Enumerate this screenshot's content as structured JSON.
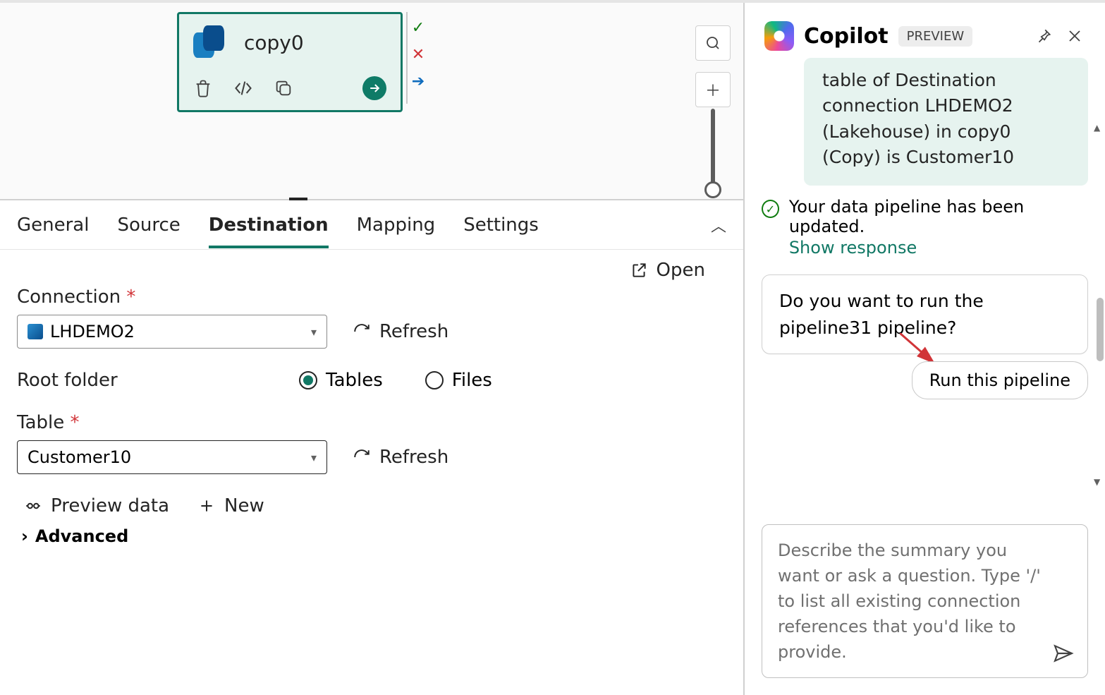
{
  "canvas": {
    "node": {
      "title": "copy0"
    },
    "search_tooltip": "Search",
    "add_tooltip": "Add"
  },
  "tabs": {
    "items": [
      {
        "label": "General"
      },
      {
        "label": "Source"
      },
      {
        "label": "Destination"
      },
      {
        "label": "Mapping"
      },
      {
        "label": "Settings"
      }
    ],
    "active_index": 2
  },
  "props": {
    "connection_label": "Connection",
    "connection_value": "LHDEMO2",
    "open_label": "Open",
    "refresh_label": "Refresh",
    "root_folder_label": "Root folder",
    "root_tables_label": "Tables",
    "root_files_label": "Files",
    "root_selected": "tables",
    "table_label": "Table",
    "table_value": "Customer10",
    "preview_label": "Preview data",
    "new_label": "New",
    "advanced_label": "Advanced"
  },
  "copilot": {
    "title": "Copilot",
    "badge": "PREVIEW",
    "message_green": "table of Destination connection LHDEMO2 (Lakehouse) in copy0 (Copy) is Customer10",
    "status_text": "Your data pipeline has been updated.",
    "status_link": "Show response",
    "question": "Do you want to run the pipeline31 pipeline?",
    "run_label": "Run this pipeline",
    "input_placeholder": "Describe the summary you want or ask a question.\nType '/' to list all existing connection references that you'd like to provide."
  }
}
